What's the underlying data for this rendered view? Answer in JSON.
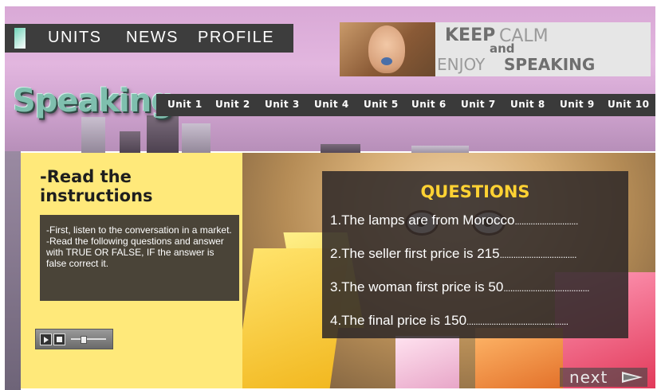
{
  "nav": {
    "items": [
      "UNITS",
      "NEWS",
      "PROFILE"
    ]
  },
  "banner": {
    "keep": "KEEP",
    "calm": "CALM",
    "and": "and",
    "enjoy": "ENJOY",
    "speaking": "SPEAKING"
  },
  "section": {
    "title": "Speaking"
  },
  "units": [
    "Unit 1",
    "Unit 2",
    "Unit 3",
    "Unit 4",
    "Unit 5",
    "Unit 6",
    "Unit 7",
    "Unit 8",
    "Unit 9",
    "Unit 10"
  ],
  "instructions": {
    "title": "-Read the instructions",
    "text": "-First, listen to the conversation in a market.\n-Read the following questions and answer with TRUE OR FALSE, IF the answer is false correct it."
  },
  "questions": {
    "title": "QUESTIONS",
    "items": [
      "1.The lamps are from Morocco",
      "2.The seller first price is 215",
      "3.The woman first price is 50",
      "4.The final price is 150"
    ]
  },
  "next": {
    "label": "next"
  },
  "colors": {
    "accent": "#ffd233",
    "panel": "#ffe97a",
    "nav": "#3d3d3d"
  }
}
